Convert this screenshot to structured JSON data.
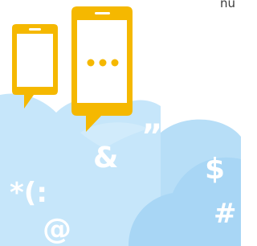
{
  "header": {
    "corner_text": "nu"
  },
  "symbols": {
    "quote": "”",
    "ampersand": "&",
    "asterisk_paren_colon": "*(:",
    "at_sign": "@",
    "dollar": "$",
    "hash": "#"
  },
  "phones": {
    "small": {
      "icon": "phone-icon"
    },
    "large": {
      "icon": "phone-icon",
      "dots": "• • •"
    }
  },
  "colors": {
    "phone_yellow": "#f5b800",
    "cloud_light": "#c6e6fa",
    "cloud_mid": "#a8d6f5",
    "cloud_back": "#b7def7",
    "symbol_white": "#ffffff"
  }
}
